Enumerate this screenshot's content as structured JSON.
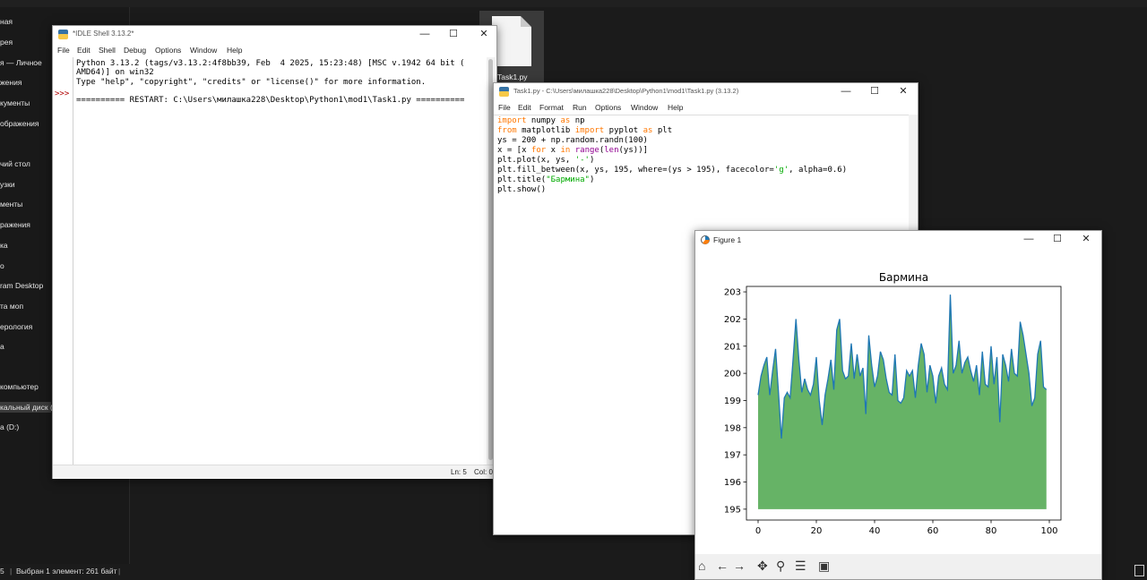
{
  "explorer": {
    "nav_items": [
      "ная",
      "рея",
      "я — Личное",
      "жения",
      "кументы",
      "ображения",
      "чий стол",
      "узки",
      "менты",
      "ражения",
      "ка",
      "о",
      "ram Desktop",
      "та моп",
      "ерология",
      "а",
      "компьютер",
      "кальный диск (C",
      "а (D:)"
    ],
    "desktop_file": "Task1.py",
    "status_left": "5",
    "status_selected": "Выбран 1 элемент: 261 байт"
  },
  "shell": {
    "title": "*IDLE Shell 3.13.2*",
    "menu": [
      "File",
      "Edit",
      "Shell",
      "Debug",
      "Options",
      "Window",
      "Help"
    ],
    "prompt": ">>>",
    "lines": [
      "Python 3.13.2 (tags/v3.13.2:4f8bb39, Feb  4 2025, 15:23:48) [MSC v.1942 64 bit (",
      "AMD64)] on win32",
      "Type \"help\", \"copyright\", \"credits\" or \"license()\" for more information.",
      "",
      "========== RESTART: C:\\Users\\милашка228\\Desktop\\Python1\\mod1\\Task1.py =========="
    ],
    "status_ln": "Ln: 5",
    "status_col": "Col: 0"
  },
  "editor": {
    "title": "Task1.py - C:\\Users\\милашка228\\Desktop\\Python1\\mod1\\Task1.py (3.13.2)",
    "menu": [
      "File",
      "Edit",
      "Format",
      "Run",
      "Options",
      "Window",
      "Help"
    ],
    "code": {
      "l1_kw": "import",
      "l1_a": " numpy ",
      "l1_kw2": "as",
      "l1_b": " np",
      "l2_kw": "from",
      "l2_a": " matplotlib ",
      "l2_kw2": "import",
      "l2_b": " pyplot ",
      "l2_kw3": "as",
      "l2_c": " plt",
      "l3": "ys = 200 + np.random.randn(100)",
      "l4_a": "x = [x ",
      "l4_kw": "for",
      "l4_b": " x ",
      "l4_kw2": "in",
      "l4_c": " ",
      "l4_bi": "range",
      "l4_d": "(",
      "l4_bi2": "len",
      "l4_e": "(ys))]",
      "l5_a": "plt.plot(x, ys, ",
      "l5_str": "'-'",
      "l5_b": ")",
      "l6_a": "plt.fill_between(x, ys, 195, where=(ys > 195), facecolor=",
      "l6_str": "'g'",
      "l6_b": ", alpha=0.6)",
      "l7_a": "plt.title(",
      "l7_str": "\"Бармина\"",
      "l7_b": ")",
      "l8": "plt.show()"
    }
  },
  "figure": {
    "title": "Figure 1",
    "toolbar_icons": [
      "home-icon",
      "back-icon",
      "forward-icon",
      "pan-icon",
      "zoom-icon",
      "configure-icon",
      "save-icon"
    ]
  },
  "chart_data": {
    "type": "area",
    "title": "Бармина",
    "xlabel": "",
    "ylabel": "",
    "xlim": [
      -4,
      104
    ],
    "ylim": [
      194.6,
      203.2
    ],
    "xticks": [
      0,
      20,
      40,
      60,
      80,
      100
    ],
    "yticks": [
      195,
      196,
      197,
      198,
      199,
      200,
      201,
      202,
      203
    ],
    "fill_baseline": 195,
    "line_color": "#1f77b4",
    "fill_color": "#008000",
    "fill_alpha": 0.6,
    "grid": false,
    "x": [
      0,
      1,
      2,
      3,
      4,
      5,
      6,
      7,
      8,
      9,
      10,
      11,
      12,
      13,
      14,
      15,
      16,
      17,
      18,
      19,
      20,
      21,
      22,
      23,
      24,
      25,
      26,
      27,
      28,
      29,
      30,
      31,
      32,
      33,
      34,
      35,
      36,
      37,
      38,
      39,
      40,
      41,
      42,
      43,
      44,
      45,
      46,
      47,
      48,
      49,
      50,
      51,
      52,
      53,
      54,
      55,
      56,
      57,
      58,
      59,
      60,
      61,
      62,
      63,
      64,
      65,
      66,
      67,
      68,
      69,
      70,
      71,
      72,
      73,
      74,
      75,
      76,
      77,
      78,
      79,
      80,
      81,
      82,
      83,
      84,
      85,
      86,
      87,
      88,
      89,
      90,
      91,
      92,
      93,
      94,
      95,
      96,
      97,
      98,
      99
    ],
    "values": [
      199.2,
      199.9,
      200.3,
      200.6,
      199.2,
      200.1,
      200.9,
      199.3,
      197.6,
      199.1,
      199.3,
      199.1,
      200.5,
      202.0,
      200.5,
      199.3,
      199.8,
      199.4,
      199.2,
      199.6,
      200.6,
      199.0,
      198.1,
      199.2,
      199.8,
      200.5,
      199.4,
      201.6,
      202.0,
      200.1,
      199.8,
      199.9,
      201.1,
      199.8,
      200.7,
      199.9,
      200.2,
      198.5,
      201.4,
      200.3,
      199.5,
      199.9,
      200.8,
      200.5,
      199.8,
      199.3,
      199.2,
      200.7,
      199.0,
      198.9,
      199.1,
      200.1,
      199.9,
      200.1,
      199.1,
      200.3,
      201.1,
      200.7,
      199.3,
      200.3,
      199.9,
      198.9,
      199.9,
      200.2,
      199.6,
      199.4,
      202.9,
      200.0,
      200.3,
      201.2,
      200.0,
      200.4,
      200.6,
      200.1,
      199.7,
      200.3,
      199.2,
      200.8,
      199.6,
      199.5,
      201.0,
      199.6,
      200.6,
      198.2,
      200.7,
      200.3,
      199.7,
      200.9,
      200.0,
      199.9,
      201.9,
      201.4,
      200.7,
      200.0,
      198.8,
      199.1,
      200.7,
      201.2,
      199.5,
      199.4
    ]
  }
}
